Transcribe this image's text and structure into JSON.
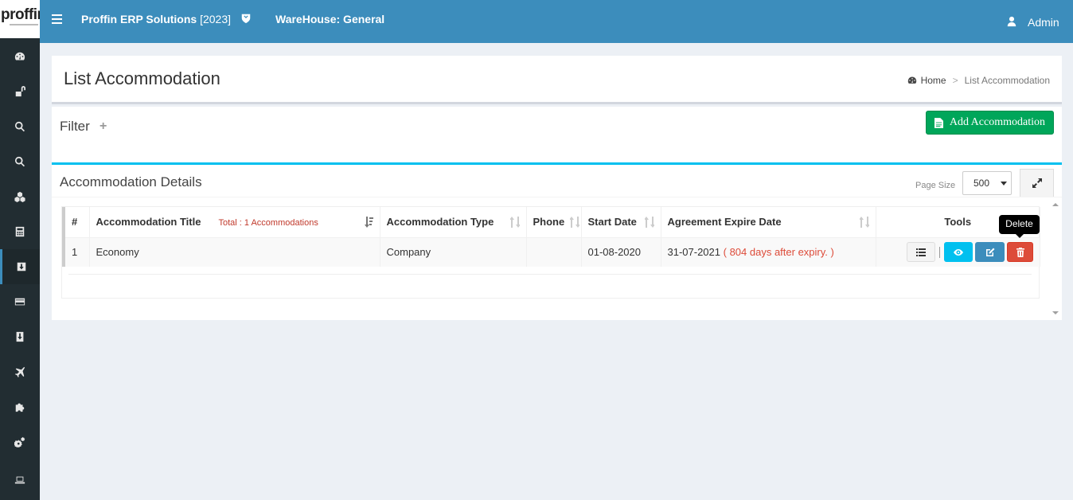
{
  "brand": {
    "logo_text": "proffin"
  },
  "topbar": {
    "app_name": "Proffin ERP Solutions",
    "app_year": "[2023]",
    "warehouse": "WareHouse: General",
    "user": "Admin"
  },
  "sidebar": {
    "items": [
      {
        "icon": "dashboard-icon"
      },
      {
        "icon": "unlock-icon"
      },
      {
        "icon": "search-icon"
      },
      {
        "icon": "search-icon"
      },
      {
        "icon": "cubes-icon"
      },
      {
        "icon": "calculator-icon"
      },
      {
        "icon": "download-icon",
        "active": true
      },
      {
        "icon": "credit-card-icon"
      },
      {
        "icon": "download-icon"
      },
      {
        "icon": "plane-icon"
      },
      {
        "icon": "puzzle-icon"
      },
      {
        "icon": "cogs-icon"
      },
      {
        "icon": "laptop-icon"
      }
    ]
  },
  "header": {
    "title": "List Accommodation",
    "breadcrumb": {
      "home": "Home",
      "separator": ">",
      "current": "List Accommodation"
    }
  },
  "filter": {
    "title": "Filter",
    "toggle": "+",
    "add_button": "Add Accommodation"
  },
  "details": {
    "title": "Accommodation Details",
    "page_size_label": "Page Size",
    "page_size_value": "500",
    "columns": {
      "num": "#",
      "title": "Accommodation Title",
      "total": "Total : 1 Accommodations",
      "type": "Accommodation Type",
      "phone": "Phone",
      "start": "Start Date",
      "expire": "Agreement Expire Date",
      "tools": "Tools"
    },
    "rows": [
      {
        "num": "1",
        "title": "Economy",
        "type": "Company",
        "phone": "",
        "start": "01-08-2020",
        "expire": "31-07-2021",
        "expiry_note": "( 804 days after expiry. )"
      }
    ]
  },
  "tooltip": "Delete",
  "colors": {
    "topbar": "#3c8dbc",
    "sidebar": "#222d32",
    "add_button": "#00a65a",
    "view_button": "#00c0ef",
    "edit_button": "#3c8dbc",
    "delete_button": "#dd4b39",
    "accent_border": "#00c0ef"
  }
}
